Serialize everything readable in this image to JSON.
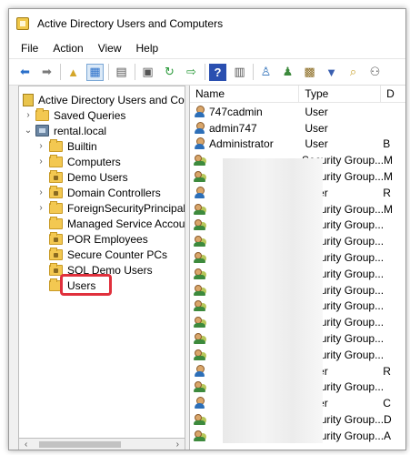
{
  "window": {
    "title": "Active Directory Users and Computers"
  },
  "menu": [
    "File",
    "Action",
    "View",
    "Help"
  ],
  "toolbar_icons": [
    "back-arrow-icon",
    "forward-arrow-icon",
    "up-folder-icon",
    "show-hide-tree-icon",
    "clipboard-icon",
    "properties-icon",
    "refresh-icon",
    "export-list-icon",
    "help-icon",
    "console-icon",
    "new-user-icon",
    "new-group-icon",
    "new-ou-icon",
    "filter-icon",
    "find-icon",
    "add-to-group-icon"
  ],
  "tree": {
    "root": "Active Directory Users and Com",
    "saved_queries": "Saved Queries",
    "domain": "rental.local",
    "items": [
      {
        "label": "Builtin",
        "expandable": true,
        "ou": false
      },
      {
        "label": "Computers",
        "expandable": true,
        "ou": false
      },
      {
        "label": "Demo Users",
        "expandable": false,
        "ou": true
      },
      {
        "label": "Domain Controllers",
        "expandable": true,
        "ou": true
      },
      {
        "label": "ForeignSecurityPrincipals",
        "expandable": true,
        "ou": false
      },
      {
        "label": "Managed Service Accour",
        "expandable": false,
        "ou": false
      },
      {
        "label": "POR Employees",
        "expandable": false,
        "ou": true
      },
      {
        "label": "Secure Counter PCs",
        "expandable": false,
        "ou": true
      },
      {
        "label": "SQL Demo Users",
        "expandable": false,
        "ou": true
      },
      {
        "label": "Users",
        "expandable": false,
        "ou": false
      }
    ],
    "selected": "Users"
  },
  "list": {
    "columns": {
      "name": "Name",
      "type": "Type",
      "desc": "D"
    },
    "rows": [
      {
        "name": "747cadmin",
        "type": "User",
        "desc": "",
        "icon": "user"
      },
      {
        "name": "admin747",
        "type": "User",
        "desc": "",
        "icon": "user"
      },
      {
        "name": "Administrator",
        "type": "User",
        "desc": "B",
        "icon": "user"
      },
      {
        "name": "",
        "type": "Security Group...",
        "desc": "M",
        "icon": "group"
      },
      {
        "name": "",
        "type": "Security Group...",
        "desc": "M",
        "icon": "group"
      },
      {
        "name": "",
        "type": "User",
        "desc": "R",
        "icon": "user"
      },
      {
        "name": "",
        "type": "Security Group...",
        "desc": "M",
        "icon": "group"
      },
      {
        "name": "",
        "type": "Security Group...",
        "desc": "",
        "icon": "group"
      },
      {
        "name": "",
        "type": "Security Group...",
        "desc": "",
        "icon": "group"
      },
      {
        "name": "",
        "type": "Security Group...",
        "desc": "",
        "icon": "group"
      },
      {
        "name": "",
        "type": "Security Group...",
        "desc": "",
        "icon": "group"
      },
      {
        "name": "",
        "type": "Security Group...",
        "desc": "",
        "icon": "group"
      },
      {
        "name": "",
        "type": "Security Group...",
        "desc": "",
        "icon": "group"
      },
      {
        "name": "",
        "type": "Security Group...",
        "desc": "",
        "icon": "group"
      },
      {
        "name": "",
        "type": "Security Group...",
        "desc": "",
        "icon": "group"
      },
      {
        "name": "",
        "type": "Security Group...",
        "desc": "",
        "icon": "group"
      },
      {
        "name": "",
        "type": "User",
        "desc": "R",
        "icon": "user"
      },
      {
        "name": "",
        "type": "Security Group...",
        "desc": "",
        "icon": "group"
      },
      {
        "name": "",
        "type": "User",
        "desc": "C",
        "icon": "user"
      },
      {
        "name": "",
        "type": "Security Group...",
        "desc": "D",
        "icon": "group"
      },
      {
        "name": "",
        "type": "Security Group...",
        "desc": "A",
        "icon": "group"
      }
    ]
  },
  "colors": {
    "highlight": "#e0303c",
    "folder": "#f3c851",
    "selection_border": "#7aa7d6"
  }
}
